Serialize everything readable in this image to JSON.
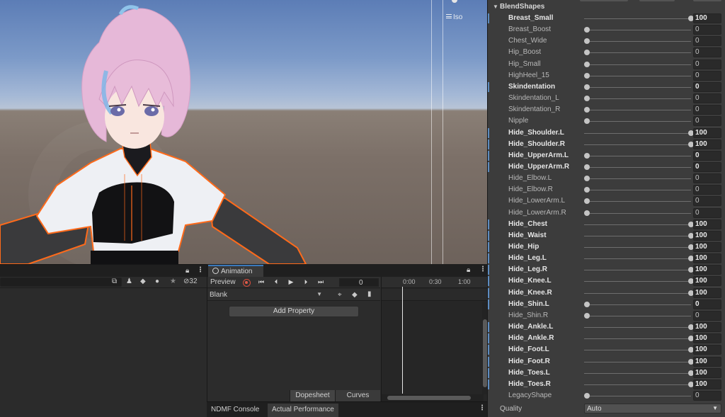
{
  "scene": {
    "iso_label": "Iso",
    "gizmo_icon": "iso-icon"
  },
  "hierarchy_toolbar": {
    "lock_icon": "lock-icon",
    "menu_icon": "kebab-menu-icon",
    "icons": [
      "scene-visibility-icon",
      "avatar-icon",
      "tag-icon",
      "warning-icon",
      "star-icon"
    ],
    "hidden_count": "32"
  },
  "animation": {
    "tab_label": "Animation",
    "preview_label": "Preview",
    "frame_value": "0",
    "clip_name": "Blank",
    "add_property_label": "Add Property",
    "ruler_labels": [
      "0:00",
      "0:30",
      "1:00"
    ],
    "dopesheet_label": "Dopesheet",
    "curves_label": "Curves"
  },
  "bottom_tabs": {
    "ndmf_console": "NDMF Console",
    "actual_performance": "Actual Performance"
  },
  "inspector": {
    "section_title": "BlendShapes",
    "blendshapes": [
      {
        "name": "Breast_Small",
        "value": 100,
        "modified": true
      },
      {
        "name": "Breast_Boost",
        "value": 0,
        "modified": false
      },
      {
        "name": "Chest_Wide",
        "value": 0,
        "modified": false
      },
      {
        "name": "Hip_Boost",
        "value": 0,
        "modified": false
      },
      {
        "name": "Hip_Small",
        "value": 0,
        "modified": false
      },
      {
        "name": "HighHeel_15",
        "value": 0,
        "modified": false
      },
      {
        "name": "Skindentation",
        "value": 0,
        "modified": true
      },
      {
        "name": "Skindentation_L",
        "value": 0,
        "modified": false
      },
      {
        "name": "Skindentation_R",
        "value": 0,
        "modified": false
      },
      {
        "name": "Nipple",
        "value": 0,
        "modified": false
      },
      {
        "name": "Hide_Shoulder.L",
        "value": 100,
        "modified": true
      },
      {
        "name": "Hide_Shoulder.R",
        "value": 100,
        "modified": true
      },
      {
        "name": "Hide_UpperArm.L",
        "value": 0,
        "modified": true
      },
      {
        "name": "Hide_UpperArm.R",
        "value": 0,
        "modified": true
      },
      {
        "name": "Hide_Elbow.L",
        "value": 0,
        "modified": false
      },
      {
        "name": "Hide_Elbow.R",
        "value": 0,
        "modified": false
      },
      {
        "name": "Hide_LowerArm.L",
        "value": 0,
        "modified": false
      },
      {
        "name": "Hide_LowerArm.R",
        "value": 0,
        "modified": false
      },
      {
        "name": "Hide_Chest",
        "value": 100,
        "modified": true
      },
      {
        "name": "Hide_Waist",
        "value": 100,
        "modified": true
      },
      {
        "name": "Hide_Hip",
        "value": 100,
        "modified": true
      },
      {
        "name": "Hide_Leg.L",
        "value": 100,
        "modified": true
      },
      {
        "name": "Hide_Leg.R",
        "value": 100,
        "modified": true
      },
      {
        "name": "Hide_Knee.L",
        "value": 100,
        "modified": true
      },
      {
        "name": "Hide_Knee.R",
        "value": 100,
        "modified": true
      },
      {
        "name": "Hide_Shin.L",
        "value": 0,
        "modified": true
      },
      {
        "name": "Hide_Shin.R",
        "value": 0,
        "modified": false
      },
      {
        "name": "Hide_Ankle.L",
        "value": 100,
        "modified": true
      },
      {
        "name": "Hide_Ankle.R",
        "value": 100,
        "modified": true
      },
      {
        "name": "Hide_Foot.L",
        "value": 100,
        "modified": true
      },
      {
        "name": "Hide_Foot.R",
        "value": 100,
        "modified": true
      },
      {
        "name": "Hide_Toes.L",
        "value": 100,
        "modified": true
      },
      {
        "name": "Hide_Toes.R",
        "value": 100,
        "modified": true
      },
      {
        "name": "LegacyShape",
        "value": 0,
        "modified": false
      }
    ],
    "quality_label": "Quality",
    "quality_value": "Auto"
  },
  "colors": {
    "accent_blue": "#3a79bb",
    "record_red": "#d84c3c",
    "outline_orange": "#ff6a1a"
  }
}
